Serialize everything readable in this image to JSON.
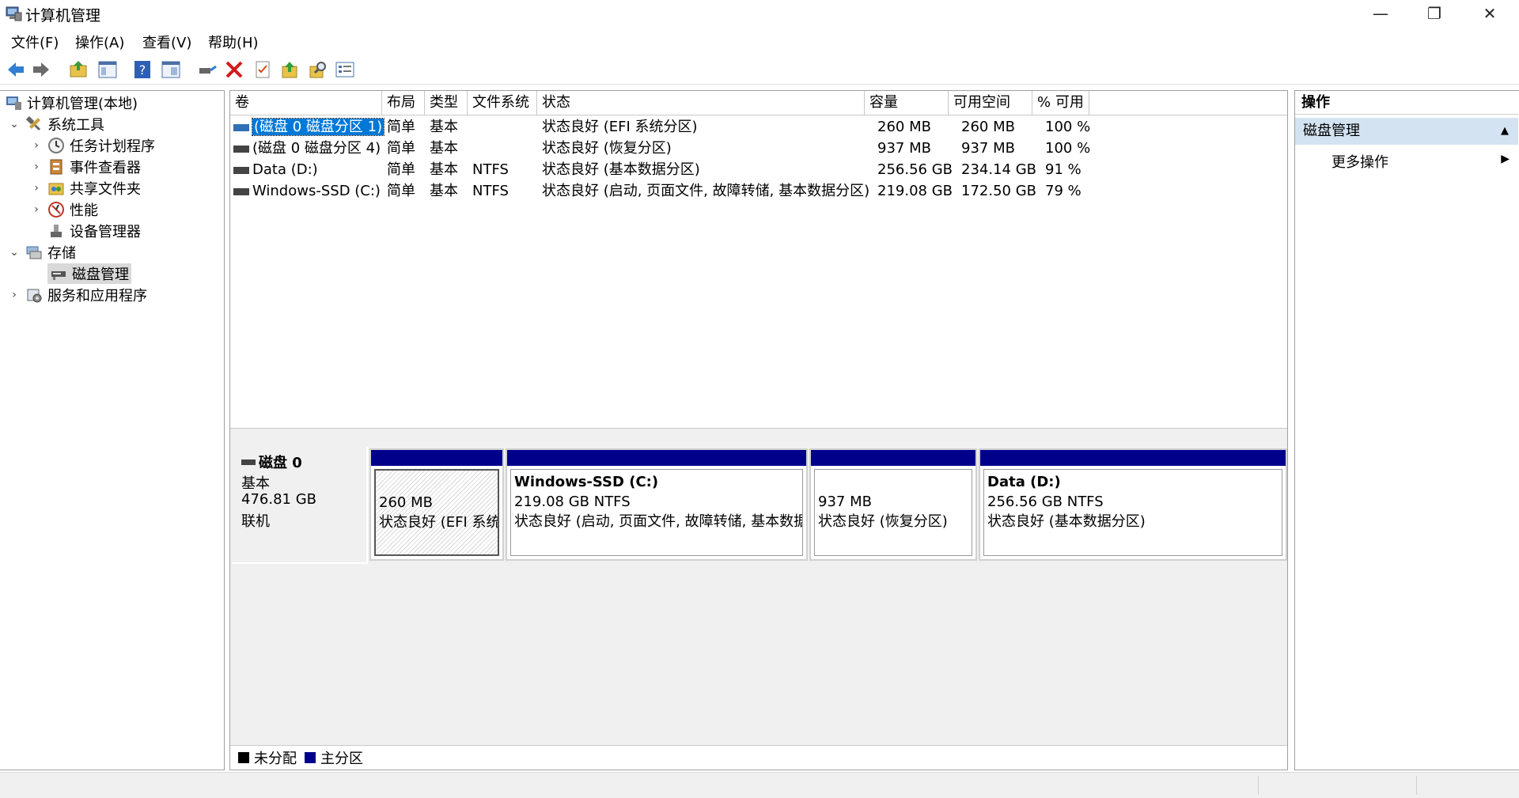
{
  "window": {
    "title": "计算机管理",
    "controls": {
      "minimize": "—",
      "restore": "❐",
      "close": "✕"
    }
  },
  "menu": [
    "文件(F)",
    "操作(A)",
    "查看(V)",
    "帮助(H)"
  ],
  "toolbar": [
    "back-icon",
    "forward-icon",
    "up-folder-icon",
    "show-tree-icon",
    "help-icon",
    "properties-icon",
    "connect-icon",
    "delete-icon",
    "checklist-icon",
    "import-icon",
    "search-icon",
    "details-icon"
  ],
  "tree": {
    "root": "计算机管理(本地)",
    "system_tools": "系统工具",
    "task_scheduler": "任务计划程序",
    "event_viewer": "事件查看器",
    "shared_folders": "共享文件夹",
    "performance": "性能",
    "device_manager": "设备管理器",
    "storage": "存储",
    "disk_management": "磁盘管理",
    "services_apps": "服务和应用程序"
  },
  "table": {
    "columns": [
      "卷",
      "布局",
      "类型",
      "文件系统",
      "状态",
      "容量",
      "可用空间",
      "% 可用"
    ],
    "rows": [
      {
        "vol": "(磁盘 0 磁盘分区 1)",
        "layout": "简单",
        "type": "基本",
        "fs": "",
        "status": "状态良好 (EFI 系统分区)",
        "cap": "260 MB",
        "free": "260 MB",
        "pct": "100 %"
      },
      {
        "vol": "(磁盘 0 磁盘分区 4)",
        "layout": "简单",
        "type": "基本",
        "fs": "",
        "status": "状态良好 (恢复分区)",
        "cap": "937 MB",
        "free": "937 MB",
        "pct": "100 %"
      },
      {
        "vol": "Data (D:)",
        "layout": "简单",
        "type": "基本",
        "fs": "NTFS",
        "status": "状态良好 (基本数据分区)",
        "cap": "256.56 GB",
        "free": "234.14 GB",
        "pct": "91 %"
      },
      {
        "vol": "Windows-SSD (C:)",
        "layout": "简单",
        "type": "基本",
        "fs": "NTFS",
        "status": "状态良好 (启动, 页面文件, 故障转储, 基本数据分区)",
        "cap": "219.08 GB",
        "free": "172.50 GB",
        "pct": "79 %"
      }
    ]
  },
  "disk": {
    "name": "磁盘 0",
    "kind": "基本",
    "size": "476.81 GB",
    "state": "联机",
    "partitions": [
      {
        "title": "",
        "size": "260 MB",
        "status": "状态良好 (EFI 系统分区)"
      },
      {
        "title": "Windows-SSD  (C:)",
        "size": "219.08 GB NTFS",
        "status": "状态良好 (启动, 页面文件, 故障转储, 基本数据分区)"
      },
      {
        "title": "",
        "size": "937 MB",
        "status": "状态良好 (恢复分区)"
      },
      {
        "title": "Data  (D:)",
        "size": "256.56 GB NTFS",
        "status": "状态良好 (基本数据分区)"
      }
    ]
  },
  "legend": {
    "unallocated": "未分配",
    "primary": "主分区",
    "unallocated_color": "#000000",
    "primary_color": "#00008b"
  },
  "actions": {
    "header": "操作",
    "section": "磁盘管理",
    "more": "更多操作"
  },
  "colors": {
    "selection": "#0078d7",
    "action_section": "#d4e3f2",
    "partition_bar": "#00008b"
  }
}
